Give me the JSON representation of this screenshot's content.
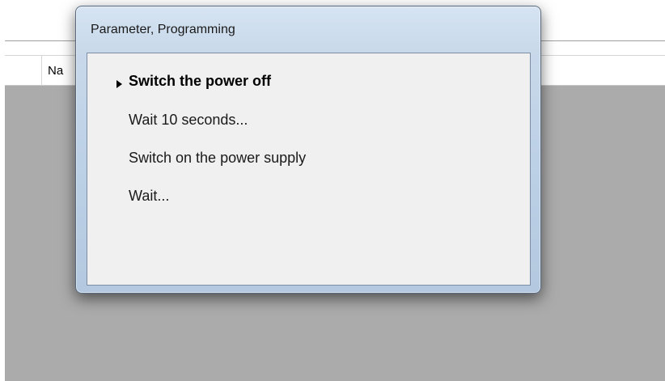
{
  "background_window": {
    "column_header": "Na"
  },
  "dialog": {
    "title": "Parameter, Programming",
    "steps": [
      {
        "label": "Switch the power off",
        "active": true
      },
      {
        "label": "Wait 10 seconds...",
        "active": false
      },
      {
        "label": "Switch on the power supply",
        "active": false
      },
      {
        "label": "Wait...",
        "active": false
      }
    ],
    "current_step_indicator": "triangle-right-icon"
  },
  "colors": {
    "background_content": "#ababab",
    "dialog_client": "#f0f0f0",
    "dialog_frame": "#bcd0e6"
  }
}
